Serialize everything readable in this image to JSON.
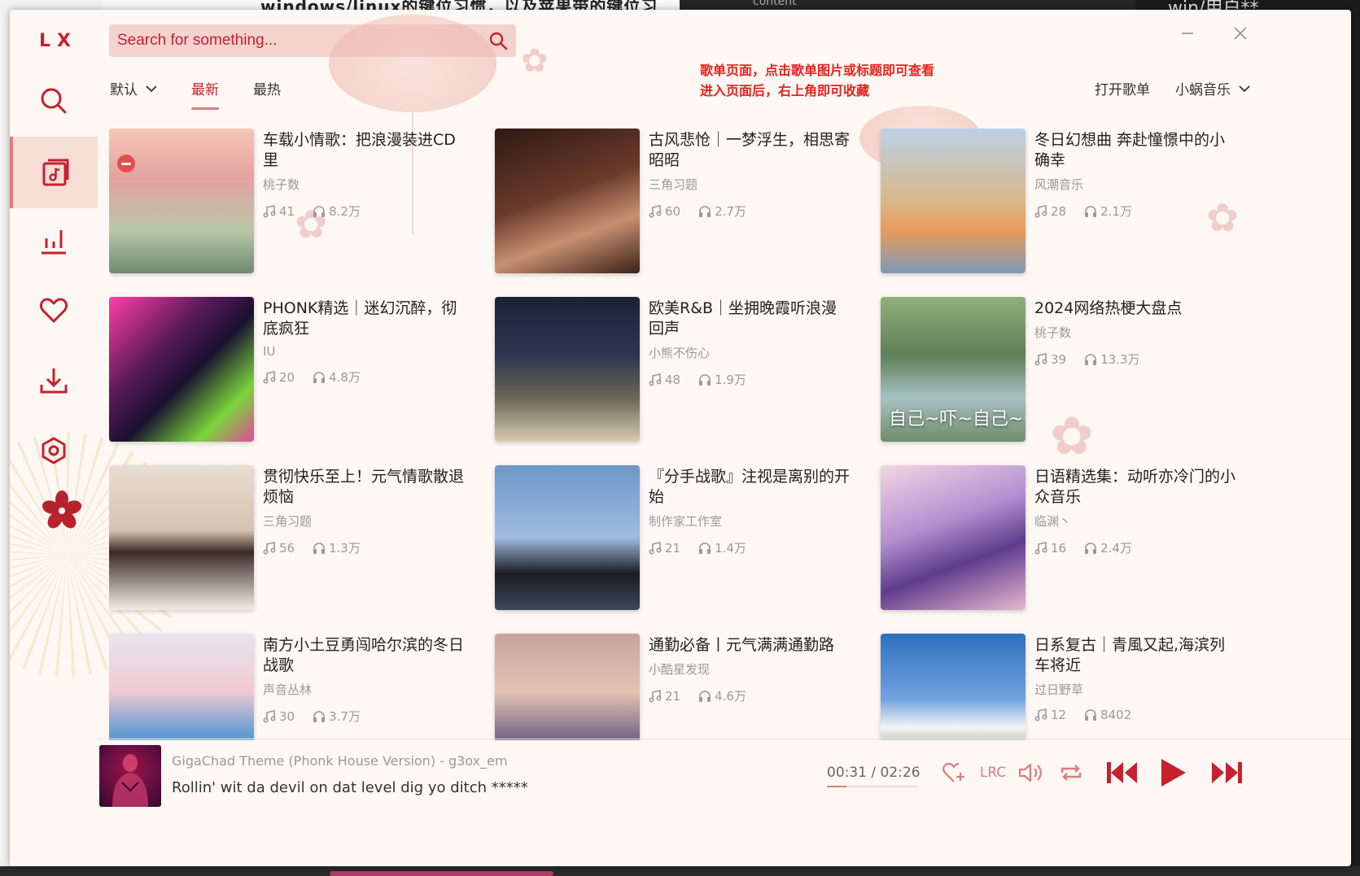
{
  "app": {
    "logo": "LX"
  },
  "search": {
    "placeholder": "Search for something..."
  },
  "tabs": [
    {
      "label": "默认"
    },
    {
      "label": "最新"
    },
    {
      "label": "最热"
    }
  ],
  "notice": {
    "line1": "歌单页面，点击歌单图片或标题即可查看",
    "line2": "进入页面后，右上角即可收藏"
  },
  "toolbar": {
    "open_playlist": "打开歌单",
    "source": "小蜗音乐"
  },
  "playlists": [
    {
      "title": "车载小情歌：把浪漫装进CD里",
      "author": "桃子数",
      "songs": "41",
      "plays": "8.2万"
    },
    {
      "title": "古风悲怆｜一梦浮生，相思寄昭昭",
      "author": "三角习题",
      "songs": "60",
      "plays": "2.7万"
    },
    {
      "title": "冬日幻想曲 奔赴憧憬中的小确幸",
      "author": "风潮音乐",
      "songs": "28",
      "plays": "2.1万"
    },
    {
      "title": "PHONK精选｜迷幻沉醉，彻底疯狂",
      "author": "IU",
      "songs": "20",
      "plays": "4.8万"
    },
    {
      "title": "欧美R&B｜坐拥晚霞听浪漫回声",
      "author": "小熊不伤心",
      "songs": "48",
      "plays": "1.9万"
    },
    {
      "title": "2024网络热梗大盘点",
      "author": "桃子数",
      "songs": "39",
      "plays": "13.3万",
      "overlay": "自己~吓~自己~"
    },
    {
      "title": "贯彻快乐至上！元气情歌散退烦恼",
      "author": "三角习题",
      "songs": "56",
      "plays": "1.3万"
    },
    {
      "title": "『分手战歌』注视是离别的开始",
      "author": "制作家工作室",
      "songs": "21",
      "plays": "1.4万"
    },
    {
      "title": "日语精选集：动听亦冷门的小众音乐",
      "author": "临渊丶",
      "songs": "16",
      "plays": "2.4万"
    },
    {
      "title": "南方小土豆勇闯哈尔滨的冬日战歌",
      "author": "声音丛林",
      "songs": "30",
      "plays": "3.7万"
    },
    {
      "title": "通勤必备丨元气满满通勤路",
      "author": "小酷星发现",
      "songs": "21",
      "plays": "4.6万"
    },
    {
      "title": "日系复古｜青風又起,海滨列车将近",
      "author": "过日野草",
      "songs": "12",
      "plays": "8402"
    }
  ],
  "player": {
    "song": "GigaChad Theme (Phonk House Version) - g3ox_em",
    "lyric": "Rollin' wit da devil on dat level dig yo ditch *****",
    "current": "00:31",
    "separator": "/",
    "total": "02:26",
    "progress": 0.21,
    "lrc_label": "LRC"
  },
  "background": {
    "doc_title": "windows/linux的键位习惯，以及苹果带的键位习",
    "editor_text": "content",
    "right_title": "win/用户**"
  },
  "colors": {
    "accent": "#c8202e",
    "accent_soft": "#e07b7b",
    "bg": "#fdf8f4"
  }
}
